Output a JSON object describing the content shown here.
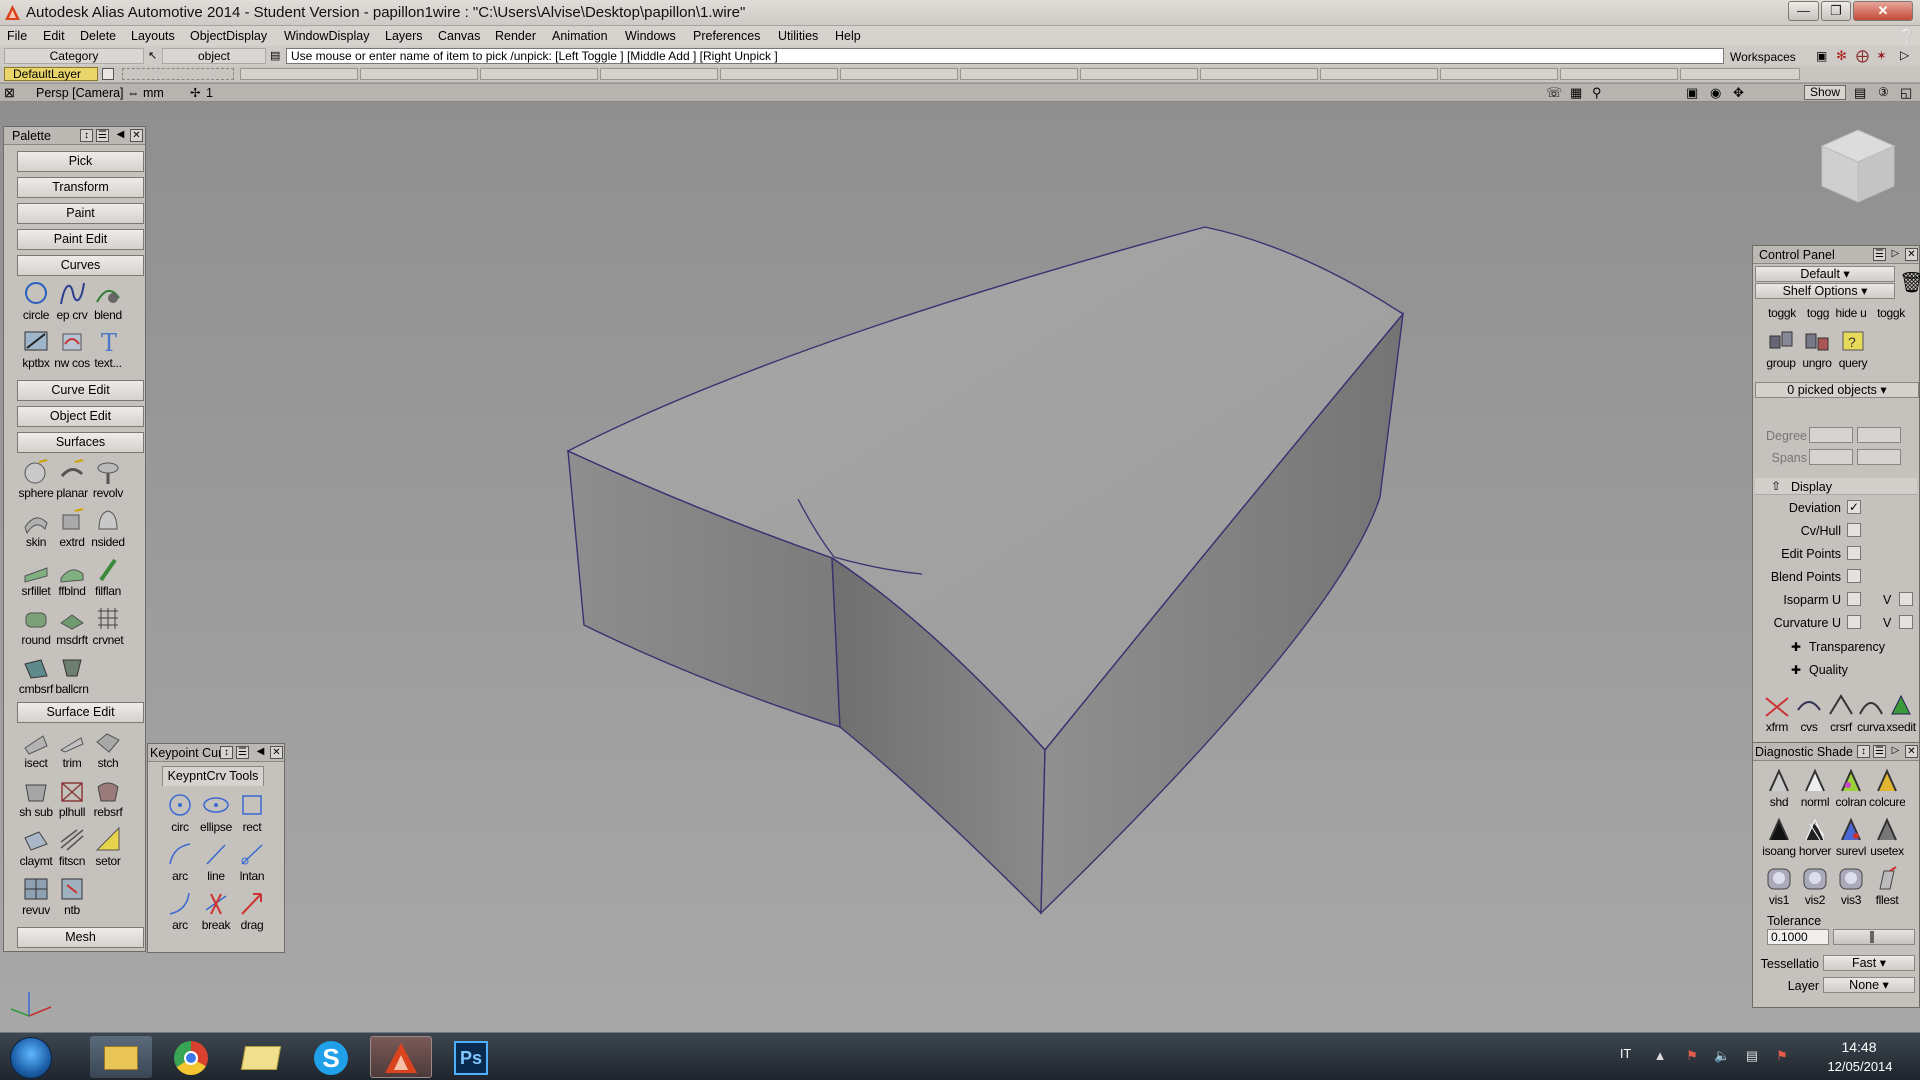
{
  "window": {
    "title": "Autodesk Alias Automotive 2014   - Student Version   - papillon1wire : \"C:\\Users\\Alvise\\Desktop\\papillon\\1.wire\"",
    "icon": "alias-logo-icon"
  },
  "menu": [
    "File",
    "Edit",
    "Delete",
    "Layouts",
    "ObjectDisplay",
    "WindowDisplay",
    "Layers",
    "Canvas",
    "Render",
    "Animation",
    "Windows",
    "Preferences",
    "Utilities",
    "Help"
  ],
  "toolbar": {
    "category_label": "Category",
    "object_label": "object",
    "prompt": "Use mouse or enter name of item to pick /unpick: [Left Toggle ] [Middle Add ] [Right Unpick ]",
    "workspaces_label": "Workspaces"
  },
  "layers": {
    "default_layer": "DefaultLayer"
  },
  "viewport": {
    "label": "Persp [Camera]  ⇔ mm",
    "grid_label": "1",
    "show_label": "Show"
  },
  "palette": {
    "title": "Palette",
    "buttons": [
      "Pick",
      "Transform",
      "Paint",
      "Paint Edit",
      "Curves",
      "Curve Edit",
      "Object Edit",
      "Surfaces",
      "Surface Edit",
      "Mesh"
    ],
    "curve_tools": [
      "circle",
      "ep crv",
      "blend",
      "kptbx",
      "nw cos",
      "text..."
    ],
    "surface_tools": [
      "sphere",
      "planar",
      "revolv",
      "skin",
      "extrd",
      "nsided",
      "srfillet",
      "ffblnd",
      "filflan",
      "round",
      "msdrft",
      "crvnet",
      "cmbsrf",
      "ballcrn"
    ],
    "surface_edit_tools": [
      "isect",
      "trim",
      "stch",
      "sh sub",
      "plhull",
      "rebsrf",
      "claymt",
      "fitscn",
      "setor",
      "revuv",
      "ntb"
    ]
  },
  "keypoint": {
    "title": "Keypoint Cur",
    "tab": "KeypntCrv Tools",
    "tools": [
      "circ",
      "ellipse",
      "rect",
      "arc",
      "line",
      "lntan",
      "arc",
      "break",
      "drag"
    ]
  },
  "control_panel": {
    "title": "Control Panel",
    "default_option": "Default",
    "shelf_options": "Shelf Options",
    "shelf_tools": [
      "toggk",
      "togg",
      "hide u",
      "toggk",
      "group",
      "ungro",
      "query"
    ],
    "picked": "0 picked objects",
    "degree_label": "Degree",
    "spans_label": "Spans",
    "display_section": "Display",
    "display_rows": [
      {
        "label": "Deviation",
        "checked": true
      },
      {
        "label": "Cv/Hull",
        "checked": false
      },
      {
        "label": "Edit Points",
        "checked": false
      },
      {
        "label": "Blend Points",
        "checked": false
      },
      {
        "label": "Isoparm U",
        "checked": false,
        "v": true
      },
      {
        "label": "Curvature U",
        "checked": false,
        "v": true
      }
    ],
    "v_label": "V",
    "transparency_label": "Transparency",
    "quality_label": "Quality",
    "bottom_tools": [
      "xfrm",
      "cvs",
      "crsrf",
      "curva",
      "xsedit"
    ]
  },
  "diagnostic": {
    "title": "Diagnostic Shade",
    "tools": [
      "shd",
      "norml",
      "colran",
      "colcurevl",
      "isoang",
      "horver",
      "surevl",
      "usetex",
      "vis1",
      "vis2",
      "vis3",
      "fllest"
    ],
    "tolerance_label": "Tolerance",
    "tolerance_value": "0.1000",
    "tessellation_label": "Tessellatio",
    "tessellation_value": "Fast",
    "layer_label": "Layer",
    "layer_value": "None"
  },
  "taskbar": {
    "apps": [
      "explorer",
      "chrome",
      "folder",
      "skype",
      "alias",
      "photoshop"
    ],
    "lang": "IT",
    "time": "14:48",
    "date": "12/05/2014"
  },
  "colors": {
    "model_stroke": "#3c3070",
    "accent_red": "#c34a37"
  }
}
